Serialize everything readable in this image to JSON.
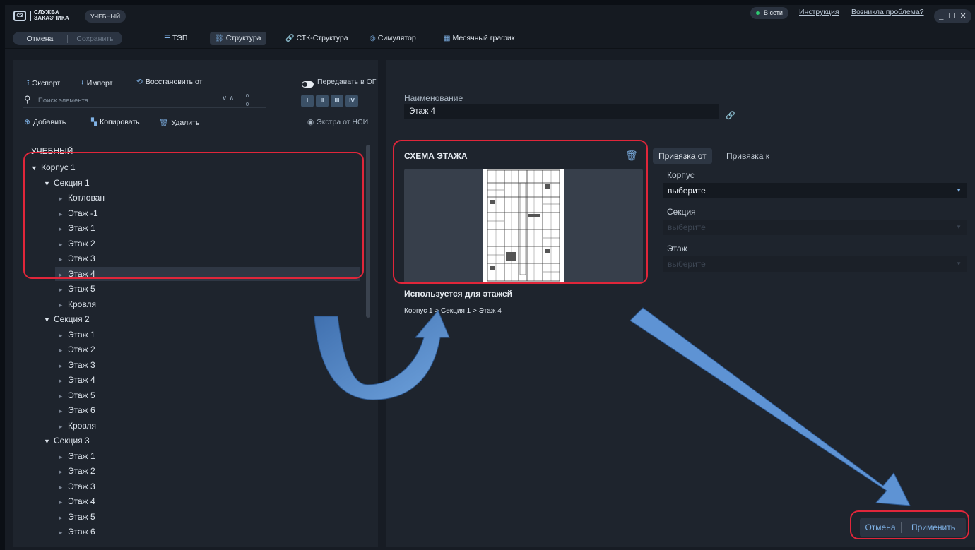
{
  "titlebar": {
    "logo_mark": "СЗ",
    "logo_line1": "СЛУЖБА",
    "logo_line2": "ЗАКАЗЧИКА",
    "env_badge": "УЧЕБНЫЙ",
    "status_online": "В сети",
    "link_instruction": "Инструкция",
    "link_problem": "Возникла проблема?",
    "status_color": "#2ec971"
  },
  "toolbar": {
    "cancel_label": "Отмена",
    "save_label": "Сохранить",
    "tabs": [
      {
        "label": "ТЭП",
        "icon": "list-icon"
      },
      {
        "label": "Структура",
        "icon": "hierarchy-icon",
        "active": true
      },
      {
        "label": "СТК-Структура",
        "icon": "link-icon"
      },
      {
        "label": "Симулятор",
        "icon": "signal-icon"
      },
      {
        "label": "Месячный график",
        "icon": "calendar-icon"
      }
    ]
  },
  "left": {
    "export_label": "Экспорт",
    "import_label": "Импорт",
    "restore_label": "Восстановить от",
    "transfer_label": "Передавать в ОГ",
    "search_placeholder": "Поиск элемента",
    "count_top": "0",
    "count_bottom": "0",
    "level_buttons": [
      "I",
      "II",
      "III",
      "IV"
    ],
    "add_label": "Добавить",
    "copy_label": "Копировать",
    "delete_label": "Удалить",
    "extra_label": "Экстра от НСИ",
    "tree_title": "УЧЕБНЫЙ",
    "tree": [
      {
        "label": "Корпус 1",
        "level": 0,
        "expanded": true
      },
      {
        "label": "Секция 1",
        "level": 1,
        "expanded": true
      },
      {
        "label": "Котлован",
        "level": 2
      },
      {
        "label": "Этаж -1",
        "level": 2
      },
      {
        "label": "Этаж 1",
        "level": 2
      },
      {
        "label": "Этаж 2",
        "level": 2
      },
      {
        "label": "Этаж 3",
        "level": 2
      },
      {
        "label": "Этаж 4",
        "level": 2,
        "selected": true
      },
      {
        "label": "Этаж 5",
        "level": 2
      },
      {
        "label": "Кровля",
        "level": 2
      },
      {
        "label": "Секция 2",
        "level": 1,
        "expanded": true
      },
      {
        "label": "Этаж 1",
        "level": 2
      },
      {
        "label": "Этаж 2",
        "level": 2
      },
      {
        "label": "Этаж 3",
        "level": 2
      },
      {
        "label": "Этаж 4",
        "level": 2
      },
      {
        "label": "Этаж 5",
        "level": 2
      },
      {
        "label": "Этаж 6",
        "level": 2
      },
      {
        "label": "Кровля",
        "level": 2
      },
      {
        "label": "Секция 3",
        "level": 1,
        "expanded": true
      },
      {
        "label": "Этаж 1",
        "level": 2
      },
      {
        "label": "Этаж 2",
        "level": 2
      },
      {
        "label": "Этаж 3",
        "level": 2
      },
      {
        "label": "Этаж 4",
        "level": 2
      },
      {
        "label": "Этаж 5",
        "level": 2
      },
      {
        "label": "Этаж 6",
        "level": 2
      }
    ]
  },
  "right": {
    "name_label": "Наименование",
    "name_value": "Этаж 4",
    "scheme_title": "СХЕМА ЭТАЖА",
    "used_title": "Используется для этажей",
    "used_path": "Корпус 1 > Секция 1 > Этаж 4",
    "tab_from": "Привязка от",
    "tab_to": "Привязка к",
    "korpus_label": "Корпус",
    "korpus_value": "выберите",
    "section_label": "Секция",
    "section_value": "выберите",
    "floor_label": "Этаж",
    "floor_value": "выберите",
    "cancel_label": "Отмена",
    "apply_label": "Применить"
  },
  "colors": {
    "accent": "#7fb2e6",
    "highlight": "#e0263a",
    "arrow": "#5b8fd0"
  }
}
